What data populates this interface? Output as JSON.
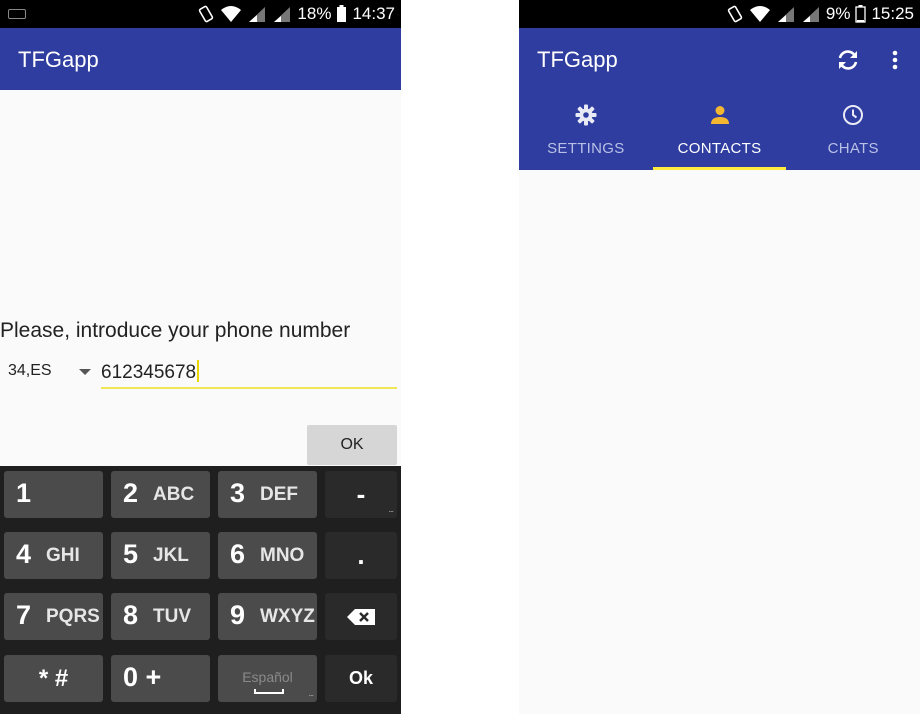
{
  "left_screen": {
    "status": {
      "battery": "18%",
      "time": "14:37"
    },
    "app_title": "TFGapp",
    "prompt": "Please, introduce your phone number",
    "country_code": "34,ES",
    "phone_value": "612345678",
    "ok_label": "OK",
    "keyboard": {
      "rows": [
        [
          {
            "digit": "1",
            "letters": ""
          },
          {
            "digit": "2",
            "letters": "ABC"
          },
          {
            "digit": "3",
            "letters": "DEF"
          },
          {
            "label": "-"
          }
        ],
        [
          {
            "digit": "4",
            "letters": "GHI"
          },
          {
            "digit": "5",
            "letters": "JKL"
          },
          {
            "digit": "6",
            "letters": "MNO"
          },
          {
            "label": "."
          }
        ],
        [
          {
            "digit": "7",
            "letters": "PQRS"
          },
          {
            "digit": "8",
            "letters": "TUV"
          },
          {
            "digit": "9",
            "letters": "WXYZ"
          },
          {
            "icon": "backspace-icon"
          }
        ],
        [
          {
            "label": "* #"
          },
          {
            "label": "0 +"
          },
          {
            "label": "Español"
          },
          {
            "label": "Ok"
          }
        ]
      ]
    }
  },
  "right_screen": {
    "status": {
      "battery": "9%",
      "time": "15:25"
    },
    "app_title": "TFGapp",
    "actions": [
      {
        "icon": "refresh-icon"
      },
      {
        "icon": "more-vert-icon"
      }
    ],
    "tabs": [
      {
        "label": "SETTINGS",
        "icon": "gear-icon",
        "active": false
      },
      {
        "label": "CONTACTS",
        "icon": "person-icon",
        "active": true
      },
      {
        "label": "CHATS",
        "icon": "clock-icon",
        "active": false
      }
    ]
  },
  "colors": {
    "primary": "#2e3d9f",
    "accent": "#ffeb3b",
    "contacts_icon": "#f5b731",
    "tab_inactive": "#b9c0e6"
  }
}
